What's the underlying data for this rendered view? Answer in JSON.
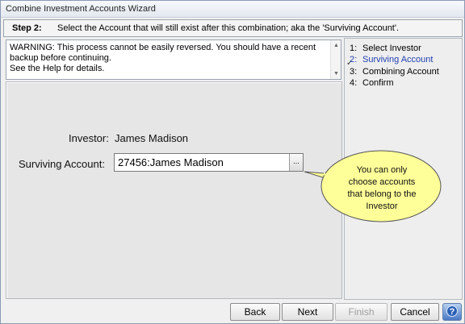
{
  "window": {
    "title": "Combine Investment Accounts Wizard"
  },
  "step": {
    "label": "Step 2:",
    "text": "Select the Account that will still exist after this combination; aka the 'Surviving Account'."
  },
  "warning": {
    "line1": "WARNING:  This process cannot be easily reversed. You should have a recent",
    "line2": "backup before continuing.",
    "line3": "See the Help for details."
  },
  "form": {
    "investor_label": "Investor:",
    "investor_value": "James Madison",
    "account_label": "Surviving Account:",
    "account_value": "27456:James Madison",
    "browse_label": "..."
  },
  "callout": {
    "line1": "You can only",
    "line2": "choose accounts",
    "line3": "that belong to the",
    "line4": "Investor"
  },
  "steps_list": [
    {
      "num": "1:",
      "label": "Select Investor"
    },
    {
      "num": "2:",
      "label": "Surviving Account"
    },
    {
      "num": "3:",
      "label": "Combining Account"
    },
    {
      "num": "4:",
      "label": "Confirm"
    }
  ],
  "buttons": {
    "back": "Back",
    "next": "Next",
    "finish": "Finish",
    "cancel": "Cancel",
    "help": "?"
  },
  "colors": {
    "callout_fill": "#ffff99",
    "active_step": "#1f3fb0"
  }
}
